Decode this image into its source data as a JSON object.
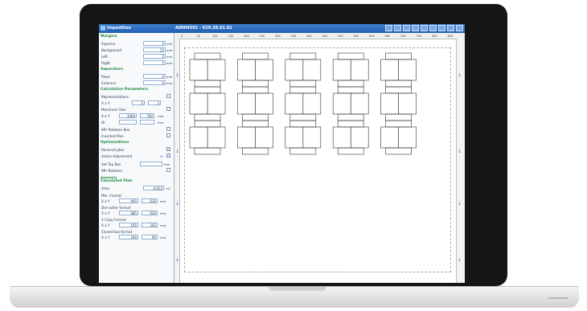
{
  "titlebar": {
    "app": "Imposition",
    "doc": "A0004591 - 629.28.01.01"
  },
  "margins": {
    "title": "Margins",
    "rows": [
      {
        "label": "Superior",
        "value": "5",
        "unit": "mm"
      },
      {
        "label": "Background",
        "value": "15",
        "unit": "mm"
      },
      {
        "label": "Left",
        "value": "5",
        "unit": "mm"
      },
      {
        "label": "Right",
        "value": "5",
        "unit": "mm"
      }
    ]
  },
  "separators": {
    "title": "Separators",
    "rows": [
      {
        "label": "Rows",
        "value": "0",
        "unit": "mm"
      },
      {
        "label": "Columns",
        "value": "0",
        "unit": "mm"
      }
    ]
  },
  "calc_params": {
    "title": "Calculation Parameters",
    "representations_label": "Representations",
    "xy_label": "X x Y",
    "rep_x": "5",
    "rep_y": "3",
    "max_size_label": "Maximum Size",
    "max_x": "1000",
    "max_y": "700",
    "max_unit": "mm",
    "or_label": "Or",
    "or_unit": "mm",
    "rotation_label": "90º Rotation Box",
    "inverted_label": "Inverted Plan"
  },
  "optimizations": {
    "title": "Optimizations",
    "reversal_label": "Reversal plan",
    "active_label": "Active Adjustment",
    "active_value": "10",
    "top_box_label": "Set Top Box",
    "top_box_unit": "mm",
    "rotation_label": "90º Rotation"
  },
  "calculated": {
    "title_a": "Assembly",
    "title_b": "Calculated Plan",
    "area_label": "Area",
    "area_value": "0,613",
    "area_unit": "m2",
    "formats": [
      {
        "label": "Min. Format",
        "x": "995",
        "y": "616",
        "unit": "mm"
      },
      {
        "label": "Die-cutter format",
        "x": "985",
        "y": "630",
        "unit": "mm"
      },
      {
        "label": "1 Copy Format",
        "x": "195",
        "y": "242",
        "unit": "mm"
      },
      {
        "label": "Closed box format",
        "x": "240",
        "y": "90",
        "unit": "mm"
      }
    ]
  },
  "ruler_ticks": [
    "0",
    "50",
    "100",
    "150",
    "200",
    "250",
    "300",
    "350",
    "400",
    "450",
    "500",
    "550",
    "600",
    "650",
    "700",
    "750",
    "800",
    "850"
  ],
  "colors": {
    "titlebar": "#2a6cc1",
    "section": "#1f8a3e",
    "arrow": "#2e6fd0",
    "bezel": "#151515"
  }
}
